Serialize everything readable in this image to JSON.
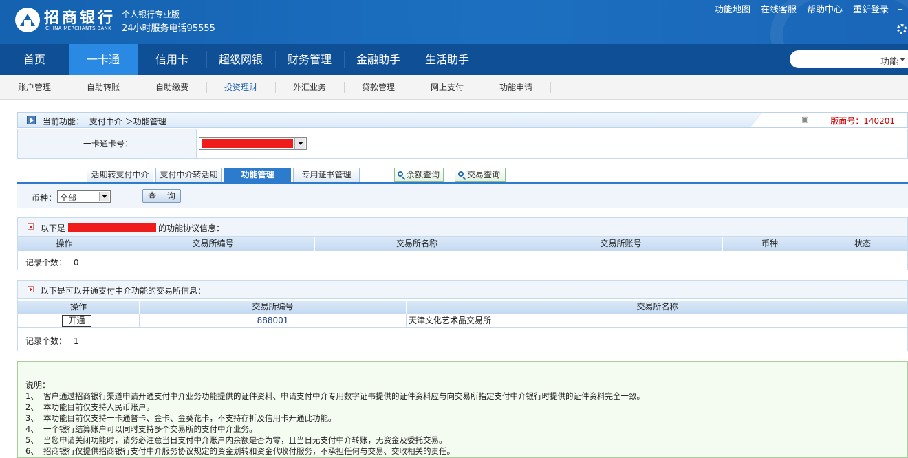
{
  "header": {
    "bank_name": "招商银行",
    "bank_name_en": "CHINA MERCHANTS BANK",
    "subtitle": "个人银行专业版",
    "hotline": "24小时服务电话95555",
    "links": [
      "功能地图",
      "在线客服",
      "帮助中心",
      "重新登录"
    ],
    "minimize": "_"
  },
  "nav": {
    "items": [
      "首页",
      "一卡通",
      "信用卡",
      "超级网银",
      "财务管理",
      "金融助手",
      "生活助手"
    ],
    "active": "一卡通",
    "search_label": "功能"
  },
  "subnav": {
    "items": [
      "账户管理",
      "自助转账",
      "自助缴费",
      "投资理财",
      "外汇业务",
      "贷款管理",
      "网上支付",
      "功能申请"
    ],
    "active": "投资理财"
  },
  "funcbar": {
    "label": "当前功能：",
    "path": "支付中介 ＞功能管理",
    "version": "版面号：140201"
  },
  "card": {
    "label": "一卡通卡号："
  },
  "tabs": [
    "活期转支付中介",
    "支付中介转活期",
    "功能管理",
    "专用证书管理"
  ],
  "active_tab": "功能管理",
  "query_buttons": [
    "余额查询",
    "交易查询"
  ],
  "currency": {
    "label": "币种：",
    "selected": "全部",
    "query_button": "查 询"
  },
  "agreements": {
    "title_prefix": "以下是",
    "title_suffix": "的功能协议信息：",
    "columns": [
      "操作",
      "交易所编号",
      "交易所名称",
      "交易所账号",
      "币种",
      "状态"
    ],
    "count_label": "记录个数：",
    "count": "0"
  },
  "exchanges": {
    "title": "以下是可以开通支付中介功能的交易所信息：",
    "columns": [
      "操作",
      "交易所编号",
      "交易所名称"
    ],
    "rows": [
      {
        "action": "开通",
        "code": "888001",
        "name": "天津文化艺术品交易所"
      }
    ],
    "count_label": "记录个数：",
    "count": "1"
  },
  "notes": {
    "title": "说明：",
    "items": [
      {
        "n": "1、",
        "text": "客户通过招商银行渠道申请开通支付中介业务功能提供的证件资料、申请支付中介专用数字证书提供的证件资料应与向交易所指定支付中介银行时提供的证件资料完全一致。"
      },
      {
        "n": "2、",
        "text": "本功能目前仅支持人民币账户。"
      },
      {
        "n": "3、",
        "text": "本功能目前仅支持一卡通普卡、金卡、金葵花卡，不支持存折及信用卡开通此功能。"
      },
      {
        "n": "4、",
        "text": "一个银行结算账户可以同时支持多个交易所的支付中介业务。"
      },
      {
        "n": "5、",
        "text": "当您申请关闭功能时，请务必注意当日支付中介账户内余额是否为零，且当日无支付中介转账，无资金及委托交易。"
      },
      {
        "n": "6、",
        "text": "招商银行仅提供招商银行支付中介服务协议规定的资金划转和资金代收付服务，不承担任何与交易、交收相关的责任。"
      }
    ]
  },
  "colors": {
    "header_blue": "#1462b0",
    "nav_blue": "#0e4f96",
    "active_blue": "#2a89e2",
    "version_red": "#cc0000",
    "redaction": "#f01b1b"
  }
}
